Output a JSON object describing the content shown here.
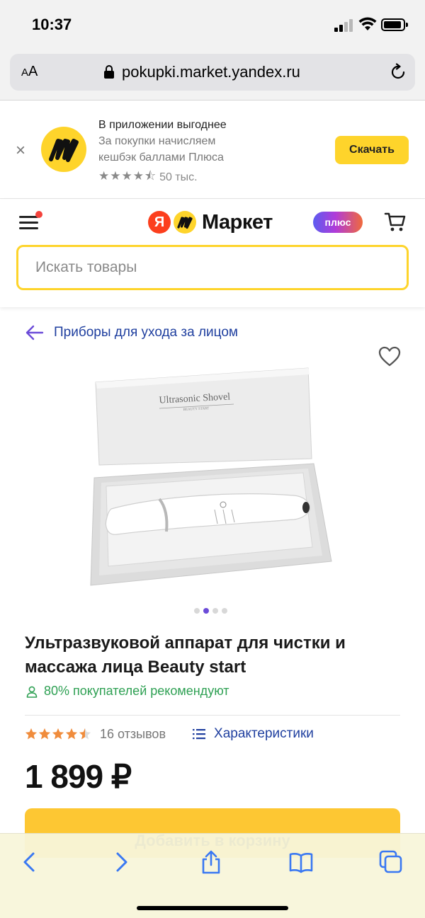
{
  "status_bar": {
    "time": "10:37"
  },
  "browser": {
    "text_size_label_small": "A",
    "text_size_label_large": "A",
    "url": "pokupki.market.yandex.ru"
  },
  "app_banner": {
    "title": "В приложении выгоднее",
    "subtitle_line1": "За покупки начисляем",
    "subtitle_line2": "кешбэк баллами Плюса",
    "rating_stars": 4.5,
    "rating_count": "50 тыс.",
    "download_label": "Скачать",
    "close_symbol": "×"
  },
  "header": {
    "logo_ya": "Я",
    "logo_text": "Маркет",
    "plus_label": "плюс",
    "search_placeholder": "Искать товары"
  },
  "breadcrumb": {
    "label": "Приборы для ухода за лицом"
  },
  "product": {
    "image_box_text": "Ultrasonic Shovel",
    "image_box_subtext": "BEAUTY START",
    "gallery": {
      "count": 4,
      "active_index": 1
    },
    "title": "Ультразвуковой аппарат для чистки и массажа лица Beauty start",
    "recommend_text": "80% покупателей рекомендуют",
    "rating": 4.5,
    "reviews": "16 отзывов",
    "specs_link": "Характеристики",
    "price": "1 899 ₽",
    "add_to_cart": "Добавить в корзину"
  },
  "colors": {
    "yandex_yellow": "#fed42b",
    "yandex_red": "#fc3f1d",
    "link_blue": "#1f3f9f",
    "recommend_green": "#2ea053",
    "star_orange": "#f08c3c"
  }
}
